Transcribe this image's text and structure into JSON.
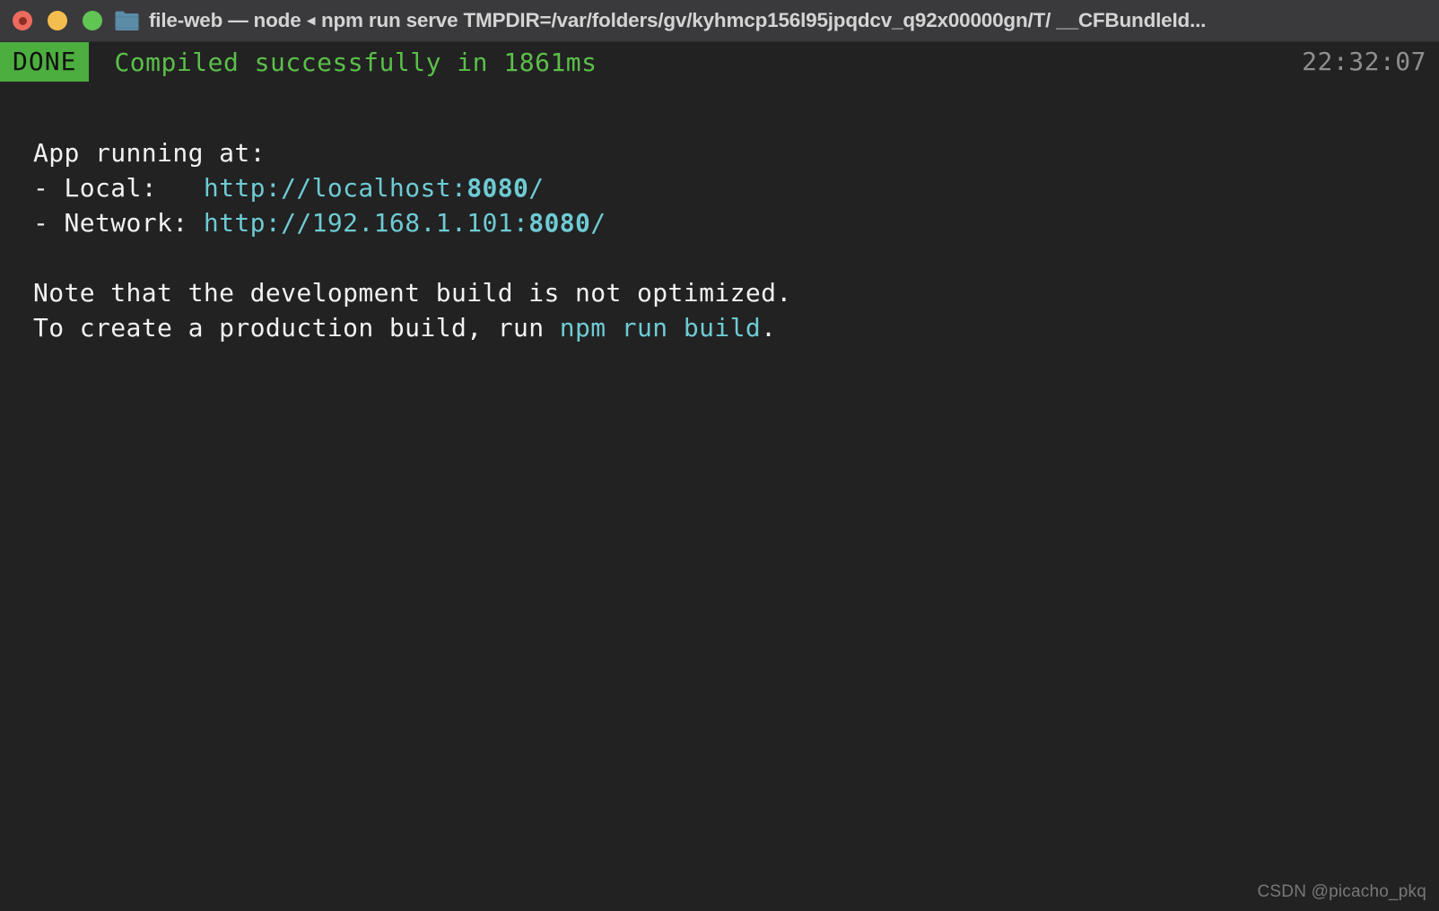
{
  "window": {
    "title_prefix": "file-web — node ",
    "separator": "◂",
    "title_suffix": " npm run serve TMPDIR=/var/folders/gv/kyhmcp156l95jpqdcv_q92x00000gn/T/ __CFBundleId...",
    "folder_icon": "folder-icon",
    "controls": {
      "close": "close-button",
      "minimize": "minimize-button",
      "zoom": "zoom-button"
    }
  },
  "status": {
    "badge": "DONE",
    "message": "Compiled successfully in 1861ms",
    "time": "22:32:07"
  },
  "console": {
    "heading": "App running at:",
    "local_label": "- Local:   ",
    "local_url_prefix": "http://localhost:",
    "local_url_port": "8080",
    "local_url_suffix": "/",
    "network_label": "- Network: ",
    "network_url_prefix": "http://192.168.1.101:",
    "network_url_port": "8080",
    "network_url_suffix": "/",
    "note_line1": "Note that the development build is not optimized.",
    "note_line2_prefix": "To create a production build, run ",
    "note_line2_command": "npm run build",
    "note_line2_suffix": "."
  },
  "watermark": "CSDN @picacho_pkq",
  "colors": {
    "background": "#222222",
    "titlebar": "#3a3a3c",
    "badge_green": "#4cae3e",
    "text_green": "#5bbf4a",
    "url_cyan": "#6ecbd4",
    "text_white": "#f2f2f2",
    "time_gray": "#8f8f8f"
  }
}
